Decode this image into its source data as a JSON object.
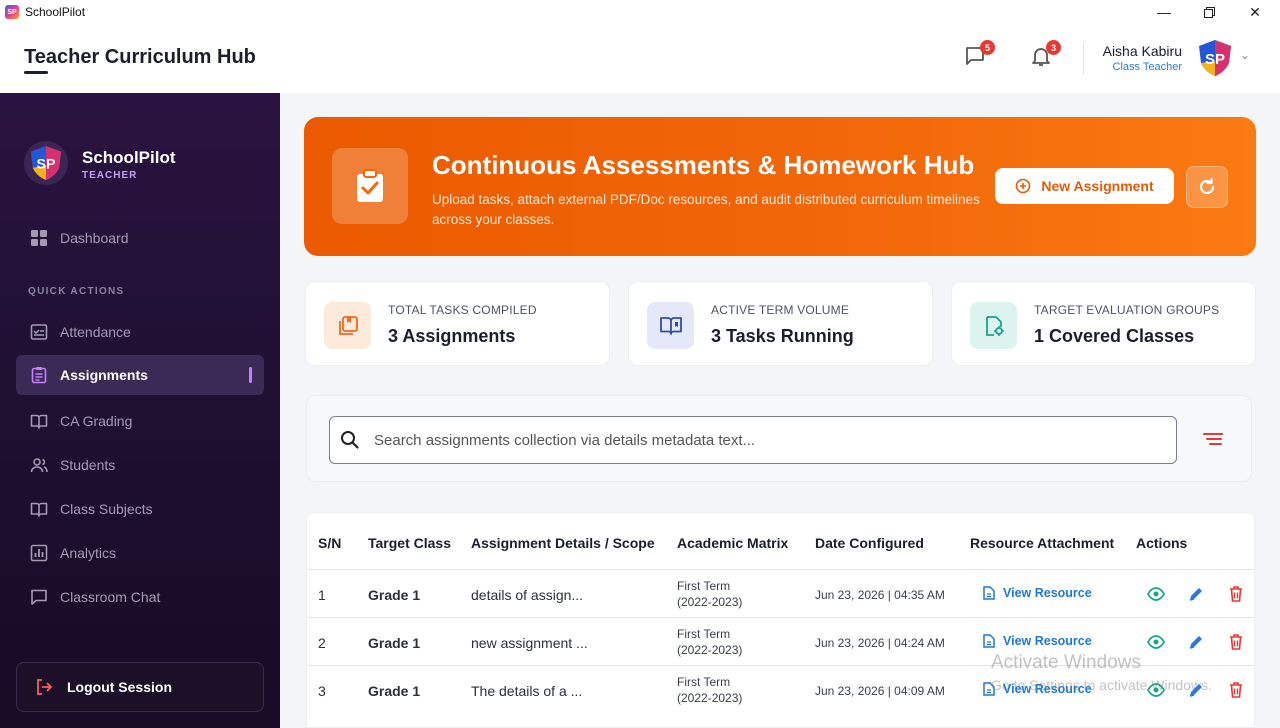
{
  "window": {
    "app_name": "SchoolPilot",
    "logo_text": "SP"
  },
  "header": {
    "title": "Teacher Curriculum Hub",
    "messages_count": "5",
    "notifications_count": "3",
    "user_name": "Aisha Kabiru",
    "user_role": "Class Teacher"
  },
  "sidebar": {
    "brand": "SchoolPilot",
    "brand_sub": "TEACHER",
    "dashboard": "Dashboard",
    "section_label": "QUICK ACTIONS",
    "items": [
      {
        "label": "Attendance",
        "icon": "attendance-icon"
      },
      {
        "label": "Assignments",
        "icon": "clipboard-icon",
        "active": true
      },
      {
        "label": "CA Grading",
        "icon": "book-open-icon"
      },
      {
        "label": "Students",
        "icon": "people-icon"
      },
      {
        "label": "Class Subjects",
        "icon": "book-open-icon"
      },
      {
        "label": "Analytics",
        "icon": "bar-chart-icon"
      },
      {
        "label": "Classroom Chat",
        "icon": "chat-icon"
      }
    ],
    "logout": "Logout Session"
  },
  "hero": {
    "title": "Continuous Assessments & Homework Hub",
    "description": "Upload tasks, attach external PDF/Doc resources, and audit distributed curriculum timelines across your classes.",
    "new_button": "New Assignment"
  },
  "stats": [
    {
      "label": "TOTAL TASKS COMPILED",
      "value": "3 Assignments"
    },
    {
      "label": "ACTIVE TERM VOLUME",
      "value": "3 Tasks Running"
    },
    {
      "label": "TARGET EVALUATION GROUPS",
      "value": "1 Covered Classes"
    }
  ],
  "search": {
    "placeholder": "Search assignments collection via details metadata text..."
  },
  "table": {
    "headers": [
      "S/N",
      "Target Class",
      "Assignment Details / Scope",
      "Academic Matrix",
      "Date Configured",
      "Resource Attachment",
      "Actions"
    ],
    "rows": [
      {
        "sn": "1",
        "class": "Grade 1",
        "details": "details of assign...",
        "term": "First Term",
        "session": "(2022-2023)",
        "date": "Jun 23, 2026 | 04:35 AM",
        "resource": "View Resource"
      },
      {
        "sn": "2",
        "class": "Grade 1",
        "details": "new assignment ...",
        "term": "First Term",
        "session": "(2022-2023)",
        "date": "Jun 23, 2026 | 04:24 AM",
        "resource": "View Resource"
      },
      {
        "sn": "3",
        "class": "Grade 1",
        "details": "The details of a ...",
        "term": "First Term",
        "session": "(2022-2023)",
        "date": "Jun 23, 2026 | 04:09 AM",
        "resource": "View Resource"
      }
    ]
  },
  "watermark": {
    "line1": "Activate Windows",
    "line2": "Go to Settings to activate Windows."
  }
}
